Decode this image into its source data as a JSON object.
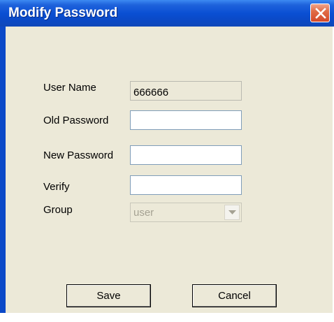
{
  "window": {
    "title": "Modify Password",
    "close_icon": "close-icon"
  },
  "form": {
    "user_name_label": "User Name",
    "user_name_value": "666666",
    "old_password_label": "Old Password",
    "old_password_value": "",
    "new_password_label": "New Password",
    "new_password_value": "",
    "verify_label": "Verify",
    "verify_value": "",
    "group_label": "Group",
    "group_value": "user"
  },
  "buttons": {
    "save_label": "Save",
    "cancel_label": "Cancel"
  },
  "colors": {
    "titlebar": "#0a4fd3",
    "dialog_bg": "#ece9d8",
    "close_button": "#e06c47"
  }
}
